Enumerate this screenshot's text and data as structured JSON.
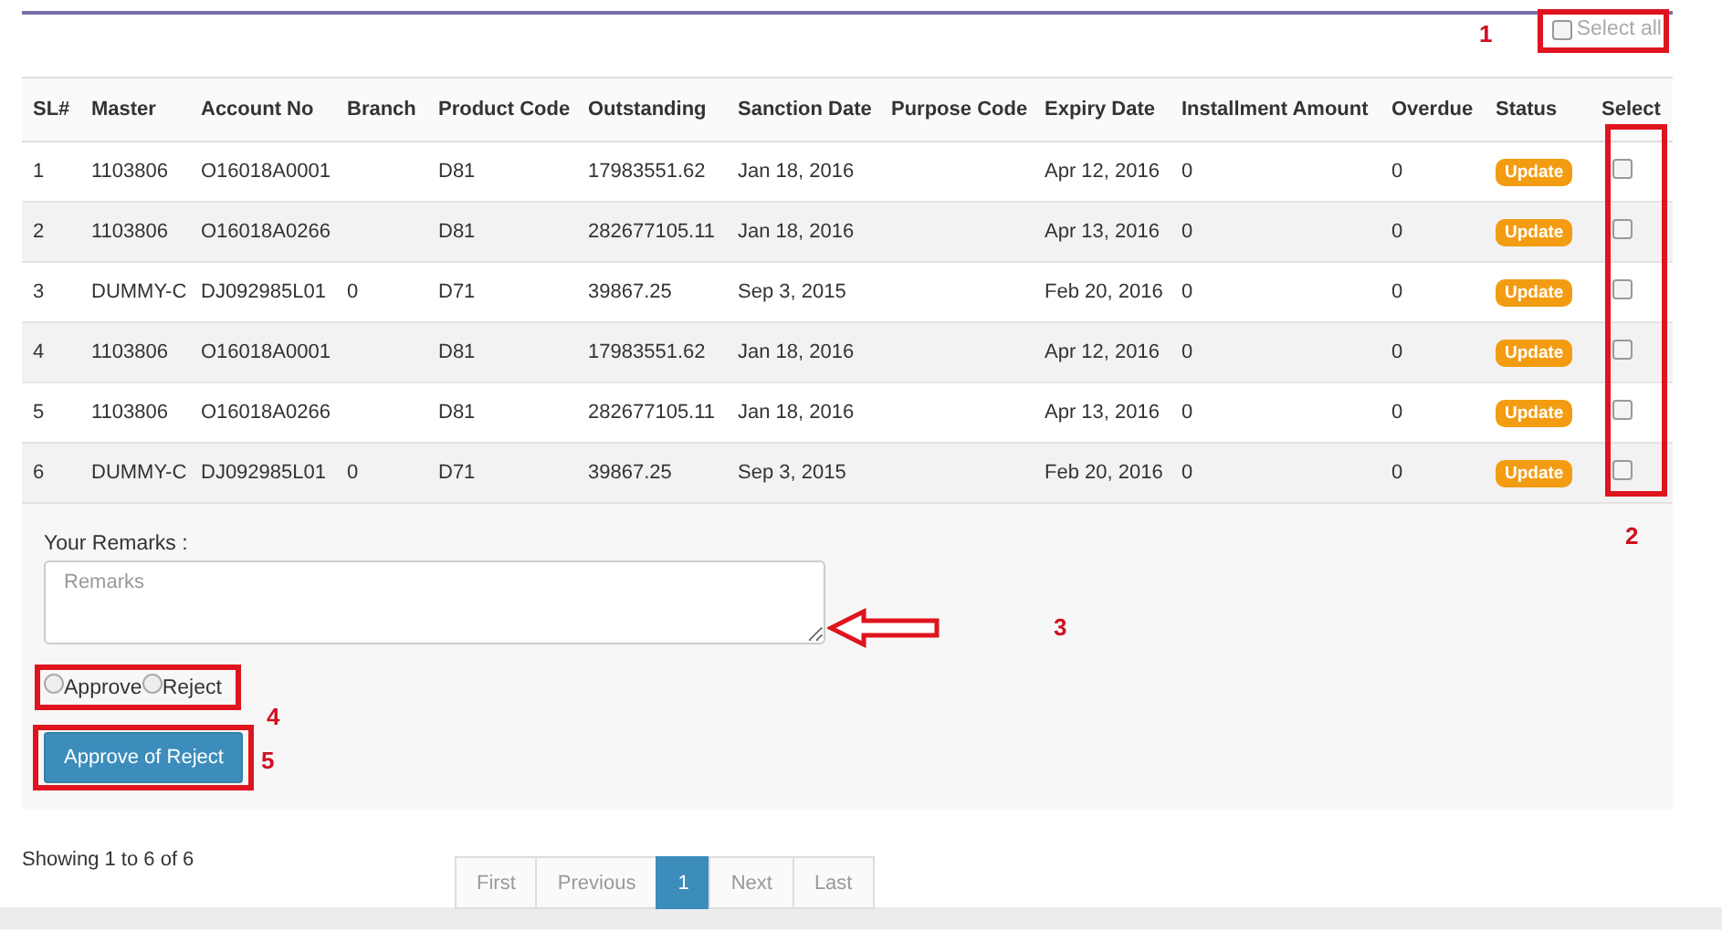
{
  "select_all": {
    "label": "Select all",
    "checked": false
  },
  "table": {
    "columns": [
      "SL#",
      "Master",
      "Account No",
      "Branch",
      "Product Code",
      "Outstanding",
      "Sanction Date",
      "Purpose Code",
      "Expiry Date",
      "Installment Amount",
      "Overdue",
      "Status",
      "Select"
    ],
    "rows": [
      {
        "cells": [
          "1",
          "1103806",
          "O16018A0001",
          "",
          "D81",
          "17983551.62",
          "Jan 18, 2016",
          "",
          "Apr 12, 2016",
          "0",
          "0"
        ],
        "status": "Update",
        "selected": false
      },
      {
        "cells": [
          "2",
          "1103806",
          "O16018A0266",
          "",
          "D81",
          "282677105.11",
          "Jan 18, 2016",
          "",
          "Apr 13, 2016",
          "0",
          "0"
        ],
        "status": "Update",
        "selected": false
      },
      {
        "cells": [
          "3",
          "DUMMY-C",
          "DJ092985L01",
          "0",
          "D71",
          "39867.25",
          "Sep 3, 2015",
          "",
          "Feb 20, 2016",
          "0",
          "0"
        ],
        "status": "Update",
        "selected": false
      },
      {
        "cells": [
          "4",
          "1103806",
          "O16018A0001",
          "",
          "D81",
          "17983551.62",
          "Jan 18, 2016",
          "",
          "Apr 12, 2016",
          "0",
          "0"
        ],
        "status": "Update",
        "selected": false
      },
      {
        "cells": [
          "5",
          "1103806",
          "O16018A0266",
          "",
          "D81",
          "282677105.11",
          "Jan 18, 2016",
          "",
          "Apr 13, 2016",
          "0",
          "0"
        ],
        "status": "Update",
        "selected": false
      },
      {
        "cells": [
          "6",
          "DUMMY-C",
          "DJ092985L01",
          "0",
          "D71",
          "39867.25",
          "Sep 3, 2015",
          "",
          "Feb 20, 2016",
          "0",
          "0"
        ],
        "status": "Update",
        "selected": false
      }
    ]
  },
  "remarks": {
    "label": "Your Remarks :",
    "placeholder": "Remarks"
  },
  "decision": [
    {
      "label": "Approve",
      "selected": false
    },
    {
      "label": "Reject",
      "selected": false
    }
  ],
  "submit_button": "Approve of Reject",
  "footer": {
    "summary": "Showing 1 to 6 of 6"
  },
  "pagination": [
    {
      "label": "First",
      "selected": false
    },
    {
      "label": "Previous",
      "selected": false
    },
    {
      "label": "1",
      "selected": true
    },
    {
      "label": "Next",
      "selected": false
    },
    {
      "label": "Last",
      "selected": false
    }
  ],
  "annotations": [
    "1",
    "2",
    "3",
    "4",
    "5"
  ]
}
